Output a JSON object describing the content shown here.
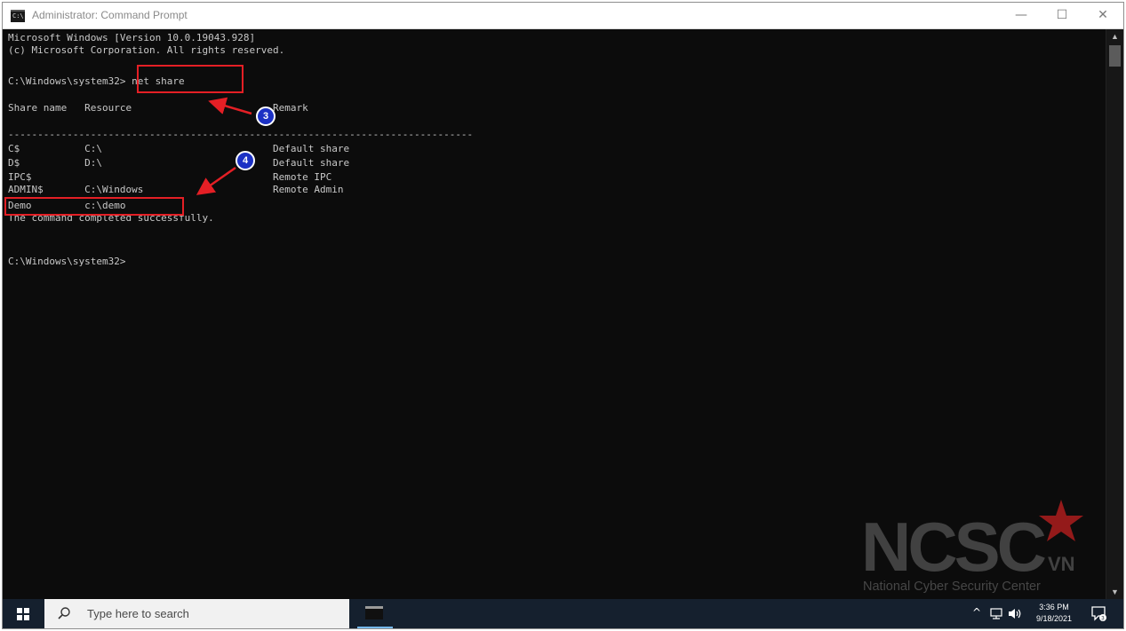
{
  "window": {
    "title": "Administrator: Command Prompt",
    "icon_text": "C:\\",
    "minimize": "—",
    "maximize": "☐",
    "close": "✕"
  },
  "console": {
    "lines": [
      "Microsoft Windows [Version 10.0.19043.928]",
      "(c) Microsoft Corporation. All rights reserved.",
      "C:\\Windows\\system32> net share",
      "Share name   Resource                        Remark",
      "-------------------------------------------------------------------------------",
      "C$           C:\\                             Default share",
      "D$           D:\\                             Default share",
      "IPC$                                         Remote IPC",
      "ADMIN$       C:\\Windows                      Remote Admin",
      "Demo         c:\\demo",
      "The command completed successfully.",
      "C:\\Windows\\system32>"
    ]
  },
  "annotations": {
    "badge_3": "3",
    "badge_4": "4"
  },
  "watermark": {
    "brand": "NCSC",
    "suffix": "VN",
    "tagline": "National Cyber Security Center"
  },
  "taskbar": {
    "search_placeholder": "Type here to search",
    "time": "3:36 PM",
    "date": "9/18/2021"
  },
  "colors": {
    "console_bg": "#0c0c0c",
    "console_text": "#c8c8c8",
    "highlight_red": "#e41f25",
    "badge_blue": "#1c31c4",
    "taskbar_bg": "#15202e"
  }
}
